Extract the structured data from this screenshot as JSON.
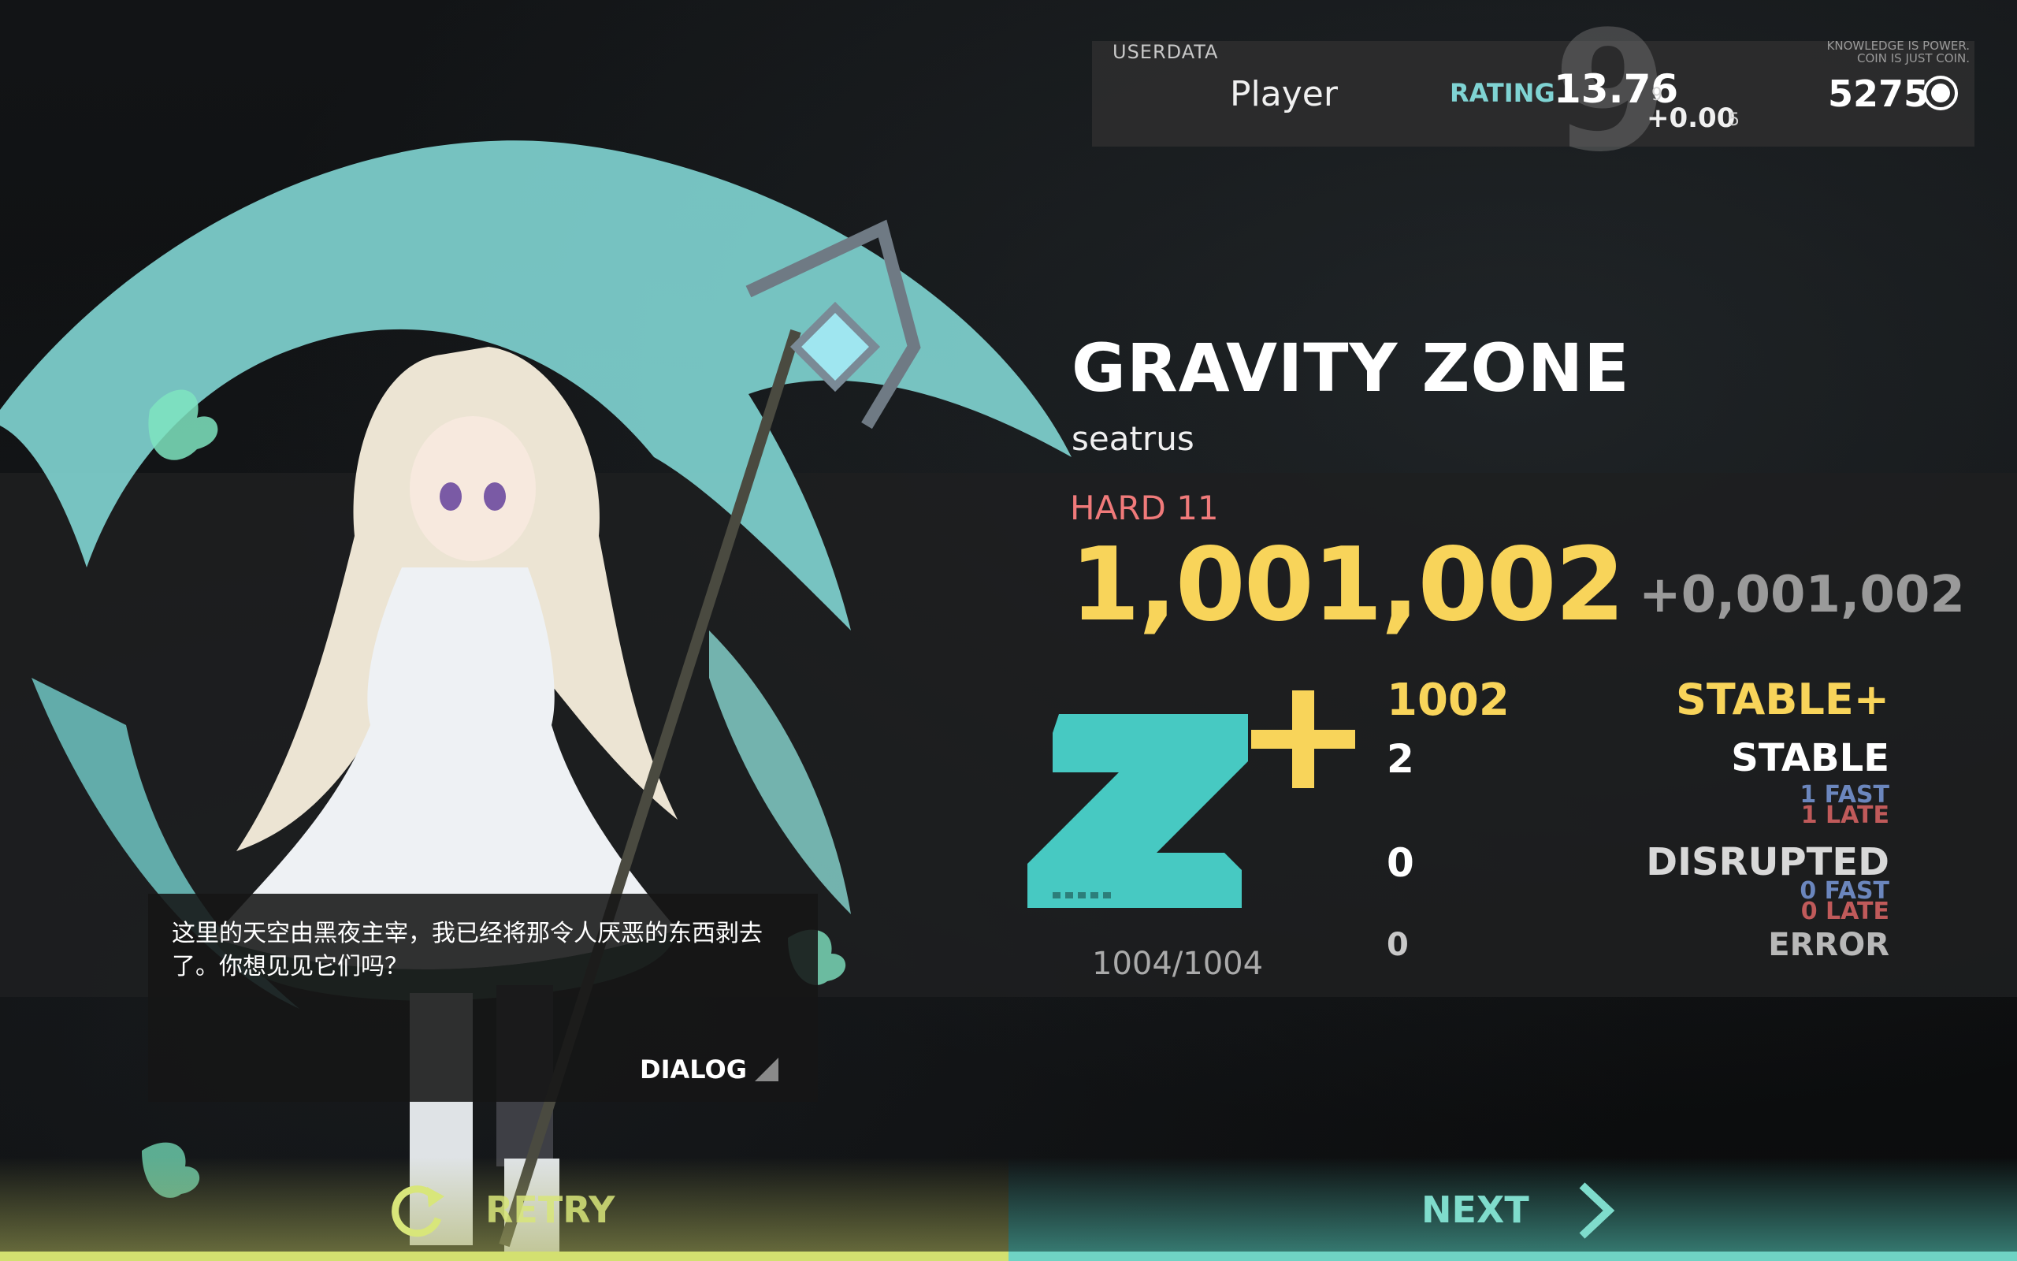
{
  "userdata": {
    "label": "USERDATA",
    "player_name": "Player",
    "level_digit": "9",
    "rating_label": "RATING",
    "rating_value": "13.76",
    "rating_sub": "9",
    "rating_delta": "+0.00",
    "rating_delta_sub": "5",
    "motto_line1": "KNOWLEDGE IS POWER.",
    "motto_line2": "COIN IS JUST COIN.",
    "coins": "5275",
    "coin_icon": "coin-icon"
  },
  "song": {
    "title": "GRAVITY ZONE",
    "artist": "seatrus",
    "difficulty": "HARD 11",
    "score": "1,001,002",
    "score_delta": "+0,001,002"
  },
  "grade": {
    "letter": "Z",
    "modifier": "+",
    "colors": {
      "z": "#47c9c2",
      "plus": "#f8d45a"
    }
  },
  "judgements": {
    "stable_plus": {
      "label": "STABLE+",
      "count": "1002"
    },
    "stable": {
      "label": "STABLE",
      "count": "2",
      "fast": "1 FAST",
      "late": "1 LATE"
    },
    "disrupted": {
      "label": "DISRUPTED",
      "count": "0",
      "fast": "0 FAST",
      "late": "0 LATE"
    },
    "error": {
      "label": "ERROR",
      "count": "0"
    }
  },
  "notes_count": "1004/1004",
  "dialog": {
    "text": "这里的天空由黑夜主宰，我已经将那令人厌恶的东西剥去了。你想见见它们吗？",
    "button_label": "DIALOG"
  },
  "buttons": {
    "retry": "RETRY",
    "next": "NEXT"
  }
}
